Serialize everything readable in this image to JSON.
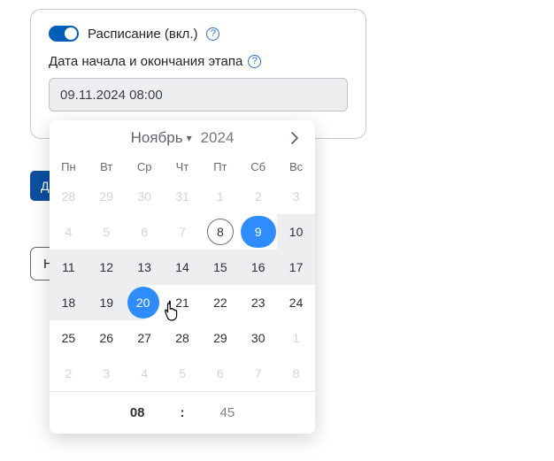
{
  "card": {
    "schedule_label": "Расписание (вкл.)",
    "date_label": "Дата начала и окончания этапа",
    "date_value": "09.11.2024 08:00"
  },
  "buttons": {
    "primary_partial": "Д",
    "outline_partial": "Н"
  },
  "dp": {
    "month": "Ноябрь",
    "year": "2024",
    "dow": [
      "Пн",
      "Вт",
      "Ср",
      "Чт",
      "Пт",
      "Сб",
      "Вс"
    ],
    "weeks": [
      [
        {
          "n": "28",
          "state": "out"
        },
        {
          "n": "29",
          "state": "out"
        },
        {
          "n": "30",
          "state": "out"
        },
        {
          "n": "31",
          "state": "out"
        },
        {
          "n": "1",
          "state": "out"
        },
        {
          "n": "2",
          "state": "out"
        },
        {
          "n": "3",
          "state": "out"
        }
      ],
      [
        {
          "n": "4",
          "state": "out"
        },
        {
          "n": "5",
          "state": "out"
        },
        {
          "n": "6",
          "state": "out"
        },
        {
          "n": "7",
          "state": "out"
        },
        {
          "n": "8",
          "state": "today"
        },
        {
          "n": "9",
          "state": "start"
        },
        {
          "n": "10",
          "state": "in-range"
        }
      ],
      [
        {
          "n": "11",
          "state": "in-range"
        },
        {
          "n": "12",
          "state": "in-range"
        },
        {
          "n": "13",
          "state": "in-range"
        },
        {
          "n": "14",
          "state": "in-range"
        },
        {
          "n": "15",
          "state": "in-range"
        },
        {
          "n": "16",
          "state": "in-range"
        },
        {
          "n": "17",
          "state": "in-range"
        }
      ],
      [
        {
          "n": "18",
          "state": "in-range"
        },
        {
          "n": "19",
          "state": "in-range"
        },
        {
          "n": "20",
          "state": "hover-end"
        },
        {
          "n": "21",
          "state": ""
        },
        {
          "n": "22",
          "state": ""
        },
        {
          "n": "23",
          "state": ""
        },
        {
          "n": "24",
          "state": ""
        }
      ],
      [
        {
          "n": "25",
          "state": ""
        },
        {
          "n": "26",
          "state": ""
        },
        {
          "n": "27",
          "state": ""
        },
        {
          "n": "28",
          "state": ""
        },
        {
          "n": "29",
          "state": ""
        },
        {
          "n": "30",
          "state": ""
        },
        {
          "n": "1",
          "state": "out"
        }
      ],
      [
        {
          "n": "2",
          "state": "out"
        },
        {
          "n": "3",
          "state": "out"
        },
        {
          "n": "4",
          "state": "out"
        },
        {
          "n": "5",
          "state": "out"
        },
        {
          "n": "6",
          "state": "out"
        },
        {
          "n": "7",
          "state": "out"
        },
        {
          "n": "8",
          "state": "out"
        }
      ]
    ],
    "time": {
      "hh": "08",
      "sep": ":",
      "mm": "45"
    }
  }
}
